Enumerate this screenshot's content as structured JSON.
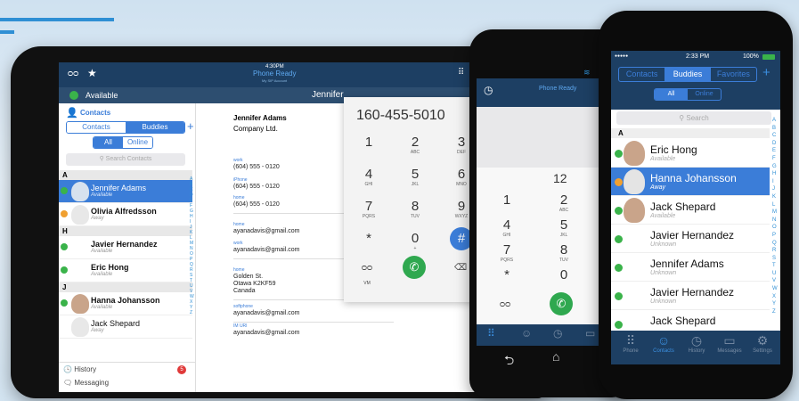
{
  "tablet": {
    "time": "4:30PM",
    "status_title": "Phone Ready",
    "status_sub": "My SIP Account",
    "available": "Available",
    "contacts_header": "Contacts",
    "tabs": [
      "Contacts",
      "Buddies"
    ],
    "filters": [
      "All",
      "Online"
    ],
    "search_placeholder": "Search Contacts",
    "detail_title": "Jennifer",
    "contact_name": "Jennifer Adams",
    "company": "Company Ltd.",
    "fields": [
      {
        "label": "work",
        "value": "(604) 555 - 0120"
      },
      {
        "label": "iPhone",
        "value": "(604) 555 - 0120"
      },
      {
        "label": "home",
        "value": "(604) 555 - 0120"
      },
      {
        "label": "home",
        "value": "ayanadavis@gmail.com"
      },
      {
        "label": "work",
        "value": "ayanadavis@gmail.com"
      },
      {
        "label": "home",
        "value": "Golden St."
      },
      {
        "label": "",
        "value": "Otawa K2KF59"
      },
      {
        "label": "",
        "value": "Canada"
      },
      {
        "label": "softphone",
        "value": "ayanadavis@gmail.com"
      },
      {
        "label": "IM URI",
        "value": "ayanadavis@gmail.com"
      }
    ],
    "sections": [
      "A",
      "H",
      "J"
    ],
    "rows": [
      {
        "name": "Jennifer Adams",
        "status": "Available"
      },
      {
        "name": "Olivia Alfredsson",
        "status": "Away"
      },
      {
        "name": "Javier Hernandez",
        "status": "Available"
      },
      {
        "name": "Eric Hong",
        "status": "Available"
      },
      {
        "name": "Hanna Johansson",
        "status": "Available"
      },
      {
        "name": "Jack Shepard",
        "status": "Away"
      }
    ],
    "history": "History",
    "history_badge": "5",
    "messaging": "Messaging",
    "dial_number": "160-455-5010",
    "keys": [
      {
        "n": "1",
        "l": ""
      },
      {
        "n": "2",
        "l": "ABC"
      },
      {
        "n": "3",
        "l": "DEF"
      },
      {
        "n": "4",
        "l": "GHI"
      },
      {
        "n": "5",
        "l": "JKL"
      },
      {
        "n": "6",
        "l": "MNO"
      },
      {
        "n": "7",
        "l": "PQRS"
      },
      {
        "n": "8",
        "l": "TUV"
      },
      {
        "n": "9",
        "l": "WXYZ"
      },
      {
        "n": "*",
        "l": ""
      },
      {
        "n": "0",
        "l": "+"
      },
      {
        "n": "#",
        "l": ""
      }
    ],
    "vm": "VM",
    "alphabet": [
      "A",
      "B",
      "C",
      "D",
      "E",
      "F",
      "G",
      "H",
      "I",
      "J",
      "K",
      "L",
      "M",
      "N",
      "O",
      "P",
      "Q",
      "R",
      "S",
      "T",
      "U",
      "V",
      "W",
      "X",
      "Y",
      "Z"
    ]
  },
  "android": {
    "status_title": "Phone Ready",
    "number": "12",
    "keys": [
      {
        "n": "1",
        "l": ""
      },
      {
        "n": "2",
        "l": "ABC"
      },
      {
        "n": "4",
        "l": "GHI"
      },
      {
        "n": "5",
        "l": "JKL"
      },
      {
        "n": "7",
        "l": "PQRS"
      },
      {
        "n": "8",
        "l": "TUV"
      },
      {
        "n": "*",
        "l": ""
      },
      {
        "n": "0",
        "l": ""
      }
    ]
  },
  "iphone": {
    "carrier": "●●●●●",
    "time": "2:33 PM",
    "battery": "100%",
    "tabs": [
      "Contacts",
      "Buddies",
      "Favorites"
    ],
    "filters": [
      "All",
      "Online"
    ],
    "search_placeholder": "Search",
    "section": "A",
    "rows": [
      {
        "name": "Eric Hong",
        "status": "Available"
      },
      {
        "name": "Hanna Johansson",
        "status": "Away"
      },
      {
        "name": "Jack Shepard",
        "status": "Available"
      },
      {
        "name": "Javier Hernandez",
        "status": "Unknown"
      },
      {
        "name": "Jennifer Adams",
        "status": "Unknown"
      },
      {
        "name": "Javier Hernandez",
        "status": "Unknown"
      },
      {
        "name": "Jack Shepard",
        "status": ""
      }
    ],
    "bottom_tabs": [
      "Phone",
      "Contacts",
      "History",
      "Messages",
      "Settings"
    ],
    "alphabet": [
      "A",
      "B",
      "C",
      "D",
      "E",
      "F",
      "G",
      "H",
      "I",
      "J",
      "K",
      "L",
      "M",
      "N",
      "O",
      "P",
      "Q",
      "R",
      "S",
      "T",
      "U",
      "V",
      "W",
      "X",
      "Y",
      "Z"
    ]
  },
  "colors": {
    "accent": "#3b7dd8",
    "available": "#3ab34a",
    "away": "#f0a030",
    "navy": "#1d3f63",
    "call_green": "#2fa84f"
  }
}
